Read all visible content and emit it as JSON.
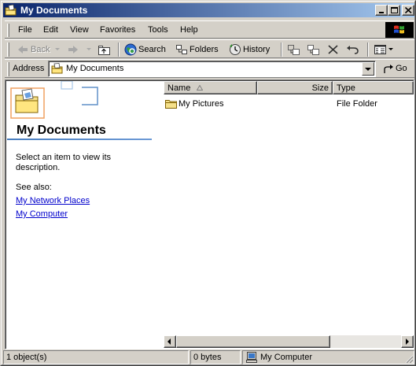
{
  "window": {
    "title": "My Documents"
  },
  "menu": {
    "items": [
      "File",
      "Edit",
      "View",
      "Favorites",
      "Tools",
      "Help"
    ]
  },
  "toolbar": {
    "back_label": "Back",
    "search_label": "Search",
    "folders_label": "Folders",
    "history_label": "History"
  },
  "address": {
    "label": "Address",
    "value": "My Documents",
    "go_label": "Go"
  },
  "left_pane": {
    "title": "My Documents",
    "description": "Select an item to view its description.",
    "see_also_label": "See also:",
    "links": [
      "My Network Places",
      "My Computer"
    ],
    "accent_color": "#4a7fc0"
  },
  "list": {
    "columns": [
      "Name",
      "Size",
      "Type"
    ],
    "rows": [
      {
        "icon": "folder-icon",
        "name": "My Pictures",
        "size": "",
        "type": "File Folder"
      }
    ]
  },
  "status": {
    "objects": "1 object(s)",
    "size": "0 bytes",
    "zone": "My Computer"
  },
  "colors": {
    "titlebar_start": "#0a246a",
    "titlebar_end": "#a6caf0",
    "face": "#d4d0c8",
    "link": "#0000cc"
  }
}
